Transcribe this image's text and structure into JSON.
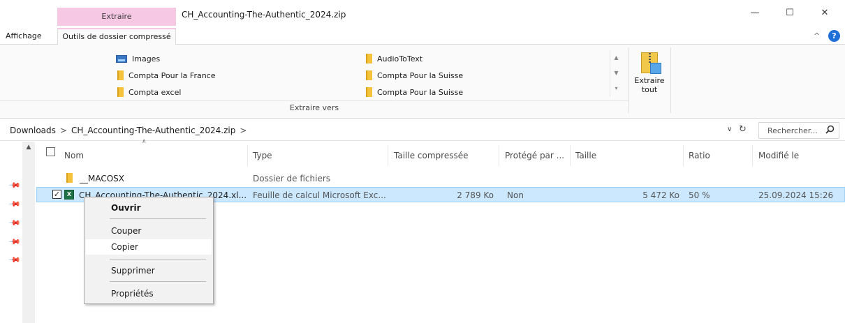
{
  "window": {
    "title": "CH_Accounting-The-Authentic_2024.zip",
    "context_tab_header": "Extraire",
    "controls": {
      "minimize": "—",
      "maximize": "☐",
      "close": "✕"
    }
  },
  "ribbon_tabs": {
    "affichage": "Affichage",
    "outils": "Outils de dossier compressé",
    "collapse": "^",
    "help": "?"
  },
  "ribbon": {
    "destinations": [
      {
        "label": "Images",
        "icon": "image-folder-icon"
      },
      {
        "label": "Compta Pour la France",
        "icon": "folder-icon"
      },
      {
        "label": "Compta excel",
        "icon": "folder-icon"
      },
      {
        "label": "AudioToText",
        "icon": "folder-icon"
      },
      {
        "label": "Compta Pour la Suisse",
        "icon": "folder-icon"
      },
      {
        "label": "Compta Pour la Suisse",
        "icon": "folder-icon"
      }
    ],
    "gallery_scroll": {
      "up": "▲",
      "down": "▼",
      "more": "▾"
    },
    "group_label": "Extraire vers",
    "extract_all": {
      "line1": "Extraire",
      "line2": "tout"
    }
  },
  "address": {
    "crumbs": [
      "Downloads",
      "CH_Accounting-The-Authentic_2024.zip"
    ],
    "separator": ">",
    "dropdown": "∨",
    "refresh": "↻",
    "search_placeholder": "Rechercher..."
  },
  "columns": {
    "name": "Nom",
    "type": "Type",
    "compressed": "Taille compressée",
    "protected": "Protégé par ...",
    "size": "Taille",
    "ratio": "Ratio",
    "modified": "Modifié le"
  },
  "rows": [
    {
      "name": "__MACOSX",
      "type": "Dossier de fichiers",
      "compressed": "",
      "protected": "",
      "size": "",
      "ratio": "",
      "modified": "",
      "icon": "folder-icon"
    },
    {
      "name": "CH_Accounting-The-Authentic_2024.xl...",
      "type": "Feuille de calcul Microsoft Exc...",
      "compressed": "2 789 Ko",
      "protected": "Non",
      "size": "5 472 Ko",
      "ratio": "50 %",
      "modified": "25.09.2024 15:26",
      "icon": "excel-file-icon",
      "selected": true,
      "check": "✓"
    }
  ],
  "context_menu": {
    "open": "Ouvrir",
    "cut": "Couper",
    "copy": "Copier",
    "delete": "Supprimer",
    "properties": "Propriétés"
  },
  "nav": {
    "scroll_up": "▲",
    "pin_glyph": "📌"
  },
  "colors": {
    "context_tab": "#f6c8e4",
    "selection": "#cce8ff",
    "selection_border": "#99d1ff",
    "folder": "#f4c23b",
    "help": "#1e6fd8"
  }
}
